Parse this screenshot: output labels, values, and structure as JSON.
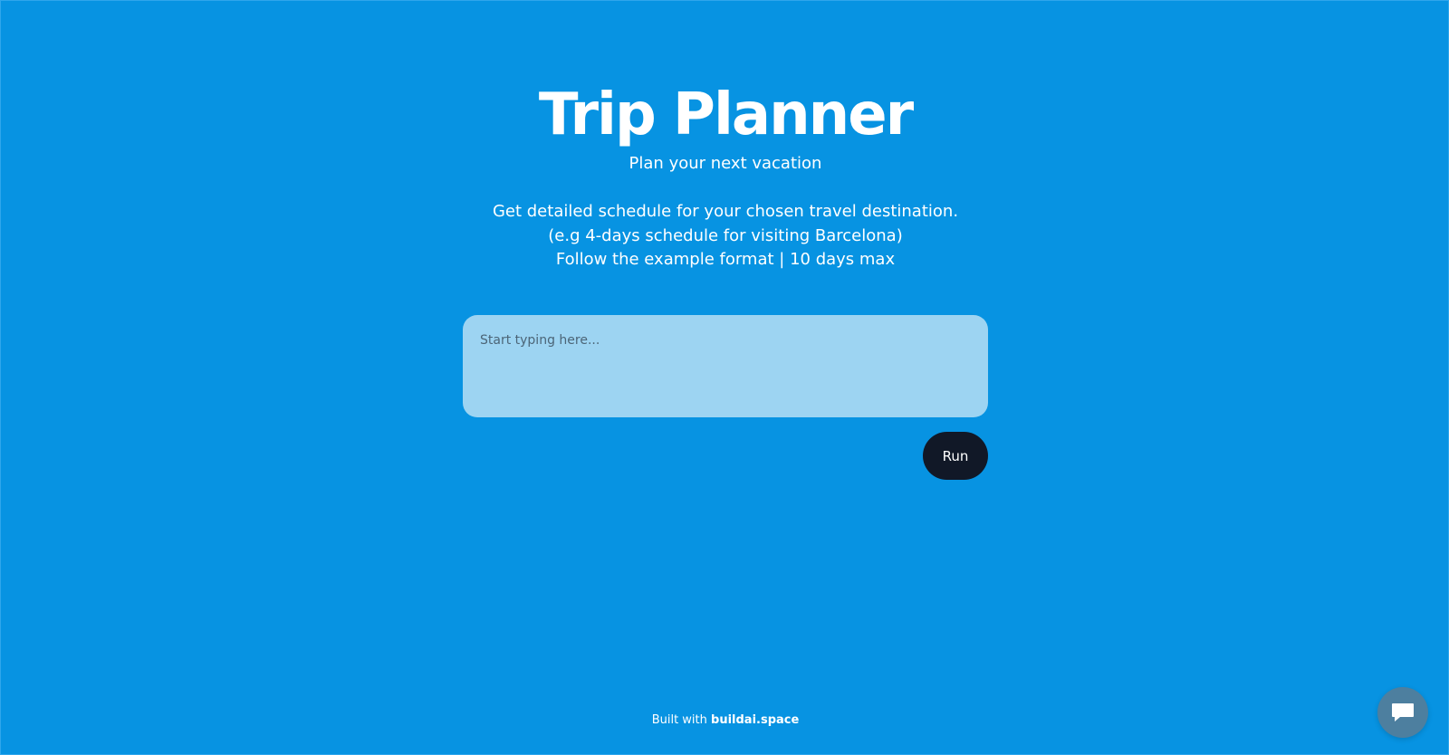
{
  "header": {
    "title": "Trip Planner",
    "subtitle": "Plan your next vacation"
  },
  "description": {
    "lines": [
      "Get detailed schedule for your chosen travel destination.",
      "(e.g 4-days schedule for visiting Barcelona)",
      "Follow the example format | 10 days max"
    ]
  },
  "prompt": {
    "placeholder": "Start typing here...",
    "value": ""
  },
  "actions": {
    "run_label": "Run"
  },
  "footer": {
    "prefix": "Built with ",
    "brand": "buildai.space"
  },
  "chat": {
    "icon": "chat-bubble-icon"
  },
  "colors": {
    "background": "#0793e2",
    "input_background": "#9dd4f2",
    "button_background": "#111827",
    "chat_launcher": "#4d7f9f"
  }
}
